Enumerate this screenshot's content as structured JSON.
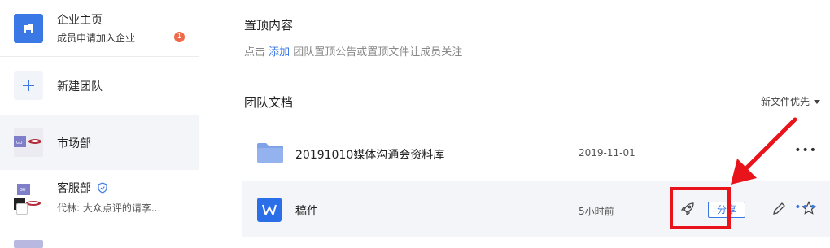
{
  "sidebar": {
    "enterprise": {
      "title": "企业主页",
      "subtitle": "成员申请加入企业",
      "badge": "1"
    },
    "new_team": {
      "label": "新建团队"
    },
    "teams": [
      {
        "name": "市场部",
        "subtitle": ""
      },
      {
        "name": "客服部",
        "subtitle": "代林: 大众点评的请李..."
      }
    ]
  },
  "main": {
    "pinned": {
      "title": "置顶内容",
      "hint_prefix": "点击 ",
      "hint_add": "添加",
      "hint_suffix": " 团队置顶公告或置顶文件让成员关注"
    },
    "docs": {
      "title": "团队文档",
      "sort_label": "新文件优先",
      "rows": [
        {
          "name": "20191010媒体沟通会资料库",
          "date": "2019-11-01",
          "type": "folder"
        },
        {
          "name": "稿件",
          "date": "5小时前",
          "type": "word",
          "share_label": "分享"
        }
      ]
    }
  },
  "colors": {
    "accent": "#3a78e6",
    "highlight": "#e8131b",
    "badge": "#ee6a4a"
  }
}
